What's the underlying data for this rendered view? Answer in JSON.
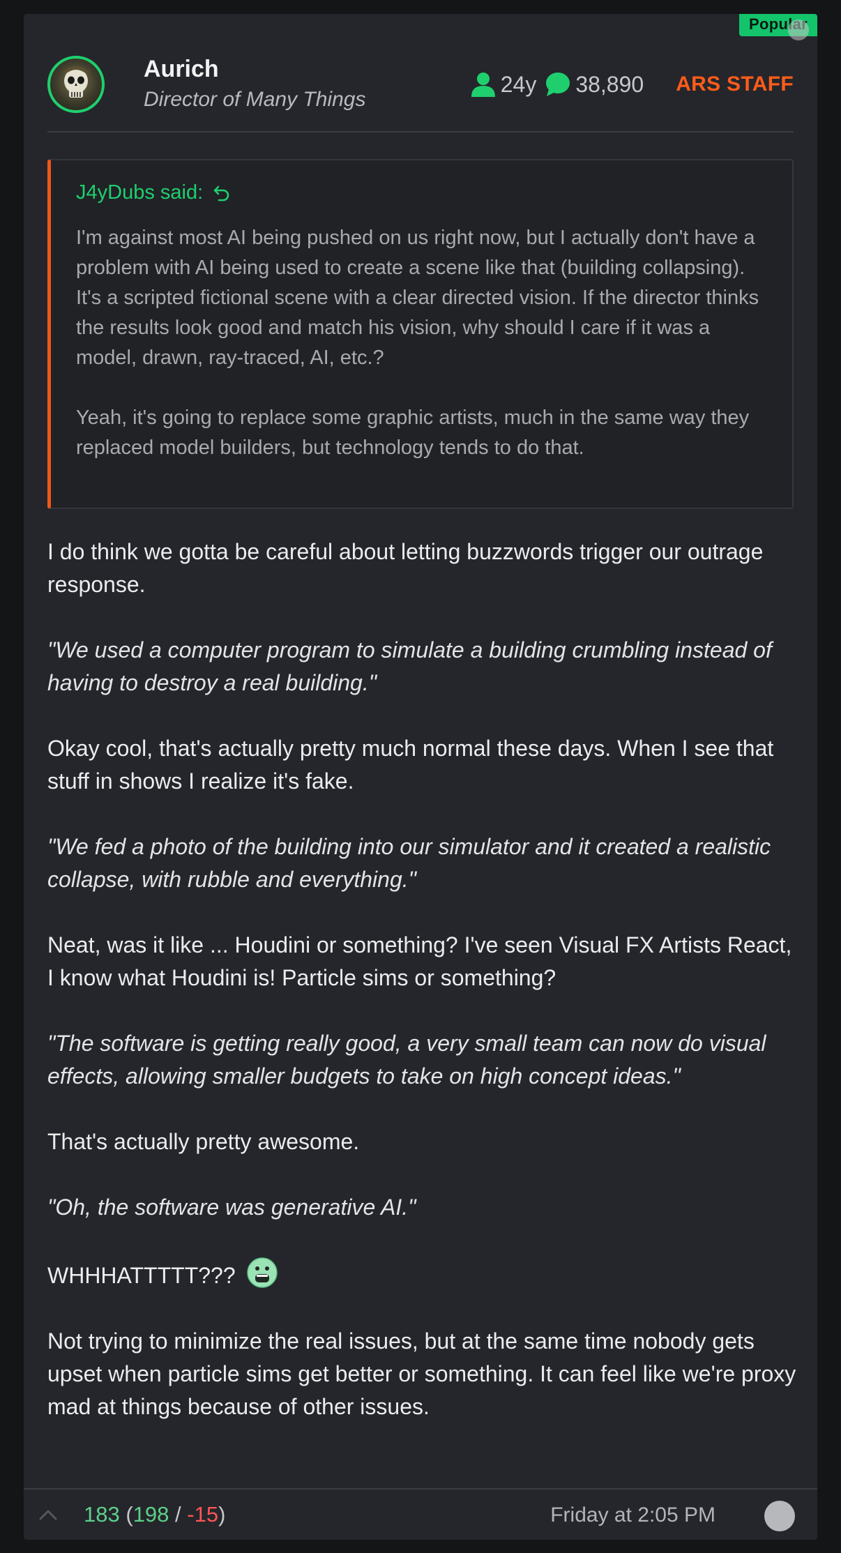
{
  "post": {
    "badge": "Popular",
    "author": {
      "name": "Aurich",
      "title": "Director of Many Things",
      "account_age": "24y",
      "post_count": "38,890",
      "role_badge": "ARS STAFF"
    },
    "quote": {
      "author_line": "J4yDubs said:",
      "paragraphs": [
        "I'm against most AI being pushed on us right now, but I actually don't have a problem with AI being used to create a scene like that (building collapsing). It's a scripted fictional scene with a clear directed vision. If the director thinks the results look good and match his vision, why should I care if it was a model, drawn, ray-traced, AI, etc.?",
        "Yeah, it's going to replace some graphic artists, much in the same way they replaced model builders, but technology tends to do that."
      ]
    },
    "body": {
      "p1": "I do think we gotta be careful about letting buzzwords trigger our outrage response.",
      "p2": "\"We used a computer program to simulate a building crumbling instead of having to destroy a real building.\"",
      "p3": "Okay cool, that's actually pretty much normal these days. When I see that stuff in shows I realize it's fake.",
      "p4": "\"We fed a photo of the building into our simulator and it created a realistic collapse, with rubble and everything.\"",
      "p5": "Neat, was it like ... Houdini or something? I've seen Visual FX Artists React, I know what Houdini is! Particle sims or something?",
      "p6": "\"The software is getting really good, a very small team can now do visual effects, allowing smaller budgets to take on high concept ideas.\"",
      "p7": "That's actually pretty awesome.",
      "p8": "\"Oh, the software was generative AI.\"",
      "p9": "WHHHATTTTT???",
      "p10": "Not trying to minimize the real issues, but at the same time nobody gets upset when particle sims get better or something. It can feel like we're proxy mad at things because of other issues."
    },
    "footer": {
      "score_net": "183",
      "score_up": "198",
      "score_down": "-15",
      "open_paren": "(",
      "slash": " / ",
      "close_paren": ")",
      "timestamp": "Friday at 2:05 PM"
    }
  },
  "colors": {
    "accent_green": "#1fcf6e",
    "staff_orange": "#ff5c1a",
    "quote_border": "#f0581a",
    "downvote_red": "#ff5555"
  },
  "icons": {
    "account_age": "user-icon",
    "posts": "speech-bubble-icon",
    "reply": "reply-arrow-icon",
    "upvote": "chevron-up-icon",
    "emoji": "shocked-face-emoji"
  }
}
